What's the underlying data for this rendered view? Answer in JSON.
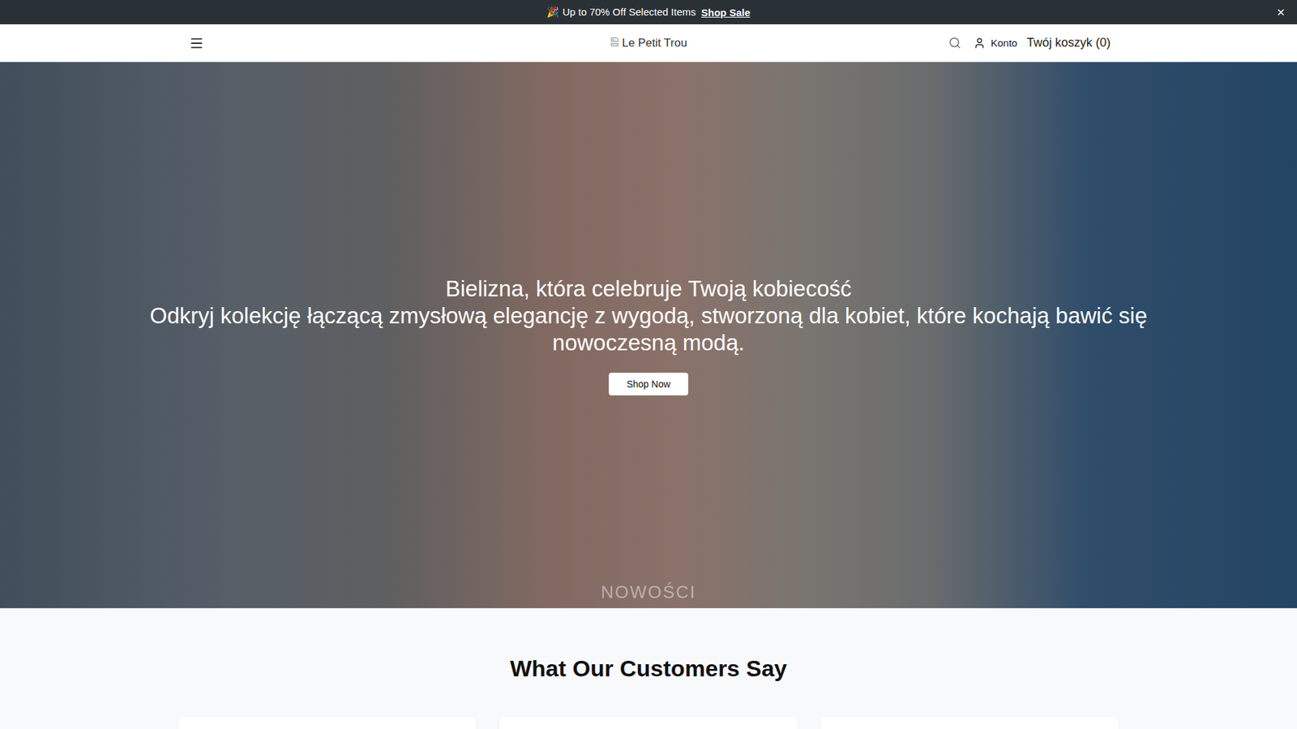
{
  "announcement": {
    "text": "🎉 Up to 70% Off Selected Items",
    "link": "Shop Sale",
    "close": "×"
  },
  "header": {
    "logo": "Le Petit Trou",
    "account": "Konto",
    "cart": "Twój koszyk (0)"
  },
  "hero": {
    "title": "Bielizna, która celebruje Twoją kobiecość",
    "subtitle": "Odkryj kolekcję łączącą zmysłową elegancję z wygodą, stworzoną dla kobiet, które kochają bawić się nowoczesną modą.",
    "button": "Shop Now",
    "label": "NOWOŚCI"
  },
  "testimonials": {
    "title": "What Our Customers Say",
    "cards": [
      {},
      {},
      {}
    ]
  }
}
